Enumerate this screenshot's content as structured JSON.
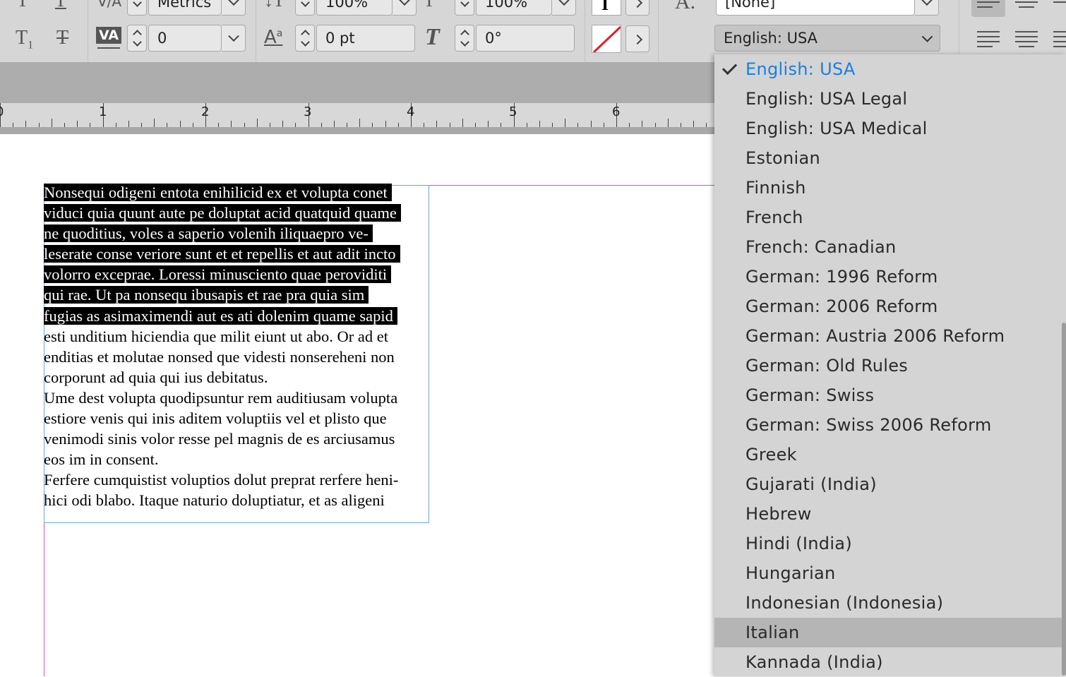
{
  "control_panel": {
    "kerning_value": "Metrics",
    "vertical_scale": "100%",
    "horizontal_scale": "100%",
    "tracking_value": "0",
    "baseline_shift": "0 pt",
    "skew_angle": "0°",
    "char_style_value": "[None]",
    "language_value": "English: USA",
    "icons": {
      "subscript": "subscript-icon",
      "strikethrough": "strikethrough-icon",
      "tracking": "tracking-icon",
      "baseline_shift": "baseline-shift-icon",
      "skew": "skew-icon",
      "no_stroke": "no-stroke-icon"
    }
  },
  "ruler": {
    "labels": [
      "0",
      "1",
      "2",
      "3",
      "4",
      "5",
      "6"
    ]
  },
  "document": {
    "lines_selected": [
      "Nonsequi odigeni entota enihilicid ex et volupta conet",
      "viduci quia quunt aute pe doluptat acid quatquid quame",
      "ne quoditius, voles a saperio volenih iliquaepro ve-",
      "leserate conse veriore sunt et et repellis et aut adit incto",
      "volorro exceprae. Loressi minusciento quae peroviditi",
      "qui rae. Ut pa nonsequ ibusapis et rae pra quia sim",
      "fugias as asimaximendi aut es ati dolenim quame sapid"
    ],
    "lines_rest": [
      "esti unditium hiciendia que milit eiunt ut abo. Or ad et",
      "enditias et molutae nonsed que videsti nonsereheni non",
      "corporunt ad quia qui ius debitatus.",
      "Ume dest volupta quodipsuntur rem auditiusam volupta",
      "estiore venis qui inis aditem voluptiis vel et plisto que",
      "venimodi sinis volor resse pel magnis de es arciusamus",
      "eos im in consent.",
      "Ferfere cumquistist voluptios dolut preprat rerfere heni-",
      "hici odi blabo. Itaque naturio doluptiatur, et as aligeni"
    ]
  },
  "language_menu": {
    "selected": "English: USA",
    "hovered": "Italian",
    "items": [
      "English: USA",
      "English: USA Legal",
      "English: USA Medical",
      "Estonian",
      "Finnish",
      "French",
      "French: Canadian",
      "German: 1996 Reform",
      "German: 2006 Reform",
      "German: Austria 2006 Reform",
      "German: Old Rules",
      "German: Swiss",
      "German: Swiss 2006 Reform",
      "Greek",
      "Gujarati (India)",
      "Hebrew",
      "Hindi (India)",
      "Hungarian",
      "Indonesian (Indonesia)",
      "Italian",
      "Kannada (India)"
    ]
  },
  "colors": {
    "panel_bg": "#d6d6d6",
    "selection_text": "#1a7fe3",
    "margin_guide": "#d050d0",
    "frame_edge": "#6aa7d8"
  }
}
